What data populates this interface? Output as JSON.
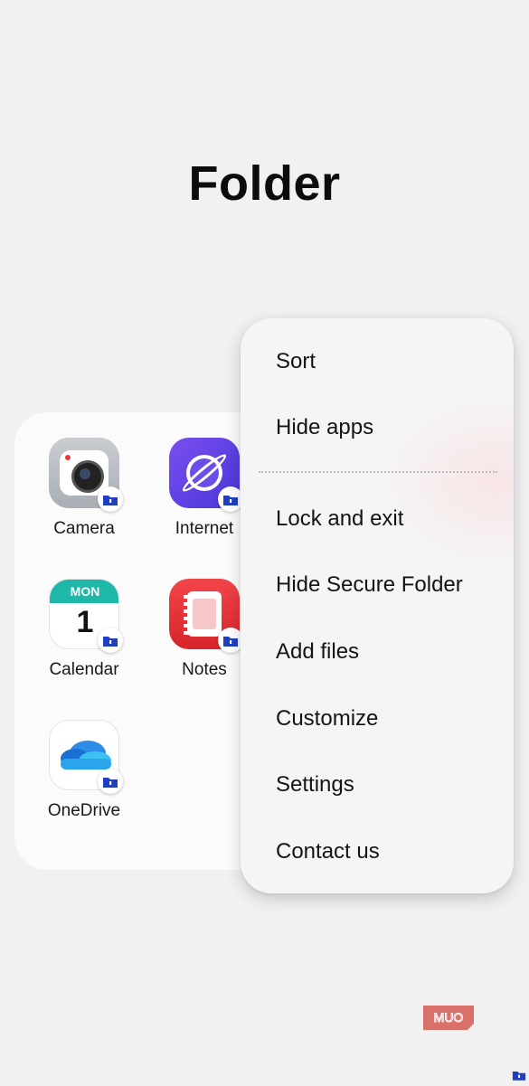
{
  "folder": {
    "title": "Folder",
    "apps": [
      {
        "label": "Camera",
        "icon": "camera-icon"
      },
      {
        "label": "Internet",
        "icon": "internet-icon"
      },
      {
        "label": "Calendar",
        "icon": "calendar-icon",
        "calendar_month": "MON",
        "calendar_day": "1"
      },
      {
        "label": "Notes",
        "icon": "notes-icon"
      },
      {
        "label": "OneDrive",
        "icon": "onedrive-icon"
      }
    ],
    "badge_icon": "secure-folder-lock-icon"
  },
  "menu": {
    "items": [
      {
        "label": "Sort"
      },
      {
        "label": "Hide apps"
      },
      {
        "label": "Lock and exit"
      },
      {
        "label": "Hide Secure Folder"
      },
      {
        "label": "Add files"
      },
      {
        "label": "Customize"
      },
      {
        "label": "Settings"
      },
      {
        "label": "Contact us"
      }
    ]
  },
  "watermark": {
    "text": "MUO",
    "color": "#d9716a"
  },
  "colors": {
    "background": "#f1f1f2",
    "panel": "#fbfbfb",
    "menu": "#f5f5f6",
    "badge_blue": "#1f3fbf",
    "calendar_teal": "#1fb8a8",
    "notes_red": "#e8333a",
    "internet_purple": "#5a3fe0"
  }
}
